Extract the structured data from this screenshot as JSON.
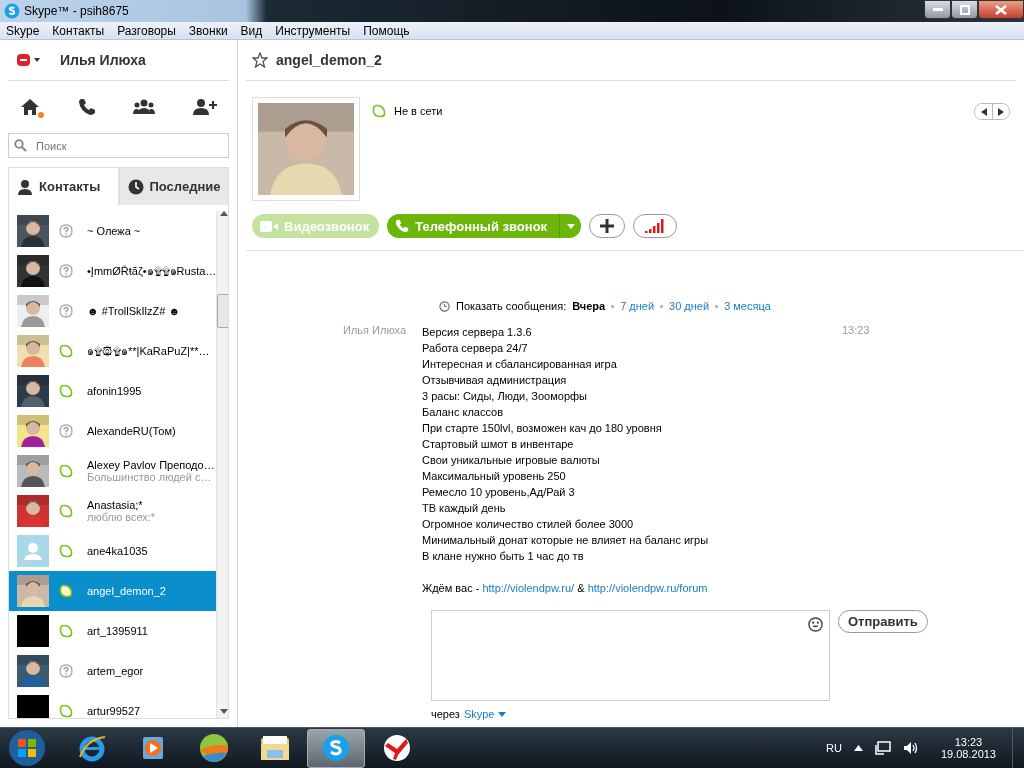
{
  "window": {
    "title": "Skype™ - psih8675"
  },
  "menu": [
    "Skype",
    "Контакты",
    "Разговоры",
    "Звонки",
    "Вид",
    "Инструменты",
    "Помощь"
  ],
  "sidebar": {
    "user": "Илья Илюха",
    "home_badge": true,
    "search": {
      "placeholder": "Поиск"
    },
    "tabs": [
      {
        "label": "Контакты",
        "selected": true
      },
      {
        "label": "Последние",
        "selected": false
      }
    ],
    "contacts": [
      {
        "name": "~ Олежа ~",
        "status_known": false,
        "kind": "picture",
        "selected": false
      },
      {
        "name": "•ĮmmØŘŧãζ•๑۩۩๑Rusta…",
        "status_known": false,
        "kind": "picture",
        "selected": false
      },
      {
        "name": "☻ #TrollSkIlzZ# ☻",
        "status_known": false,
        "kind": "picture",
        "selected": false
      },
      {
        "name": "๑۩۞۩๑**|KaRaPuZ|**…",
        "status_known": true,
        "kind": "picture",
        "selected": false
      },
      {
        "name": "afonin1995",
        "status_known": true,
        "kind": "picture",
        "selected": false
      },
      {
        "name": "AlexandeRU(Том)",
        "status_known": false,
        "kind": "picture",
        "selected": false
      },
      {
        "name": "Alexey Pavlov Преподо…",
        "mood": "Большинство людей с…",
        "status_known": true,
        "kind": "picture",
        "selected": false
      },
      {
        "name": "Anastasia;*",
        "mood": "люблю всех:*",
        "status_known": true,
        "kind": "picture",
        "selected": false
      },
      {
        "name": "ane4ka1035",
        "status_known": true,
        "kind": "default",
        "selected": false
      },
      {
        "name": "angel_demon_2",
        "status_known": true,
        "kind": "picture",
        "selected": true
      },
      {
        "name": "art_1395911",
        "status_known": true,
        "kind": "blank",
        "selected": false
      },
      {
        "name": "artem_egor",
        "status_known": false,
        "kind": "picture",
        "selected": false
      },
      {
        "name": "artur99527",
        "status_known": true,
        "kind": "blank",
        "selected": false
      }
    ]
  },
  "conversation": {
    "name": "angel_demon_2",
    "status_known": true,
    "status_text": "Не в сети",
    "buttons": [
      {
        "kind": "video",
        "label": "Видеозвонок",
        "disabled": true
      },
      {
        "kind": "phone",
        "label": "Телефонный звонок",
        "disabled": false
      },
      {
        "kind": "add",
        "disabled": false
      },
      {
        "kind": "signal",
        "disabled": false
      }
    ],
    "history": {
      "label": "Показать сообщения:",
      "options": [
        {
          "label": "Вчера",
          "selected": true
        },
        {
          "label": "7 дней",
          "selected": false
        },
        {
          "label": "30 дней",
          "selected": false
        },
        {
          "label": "3 месяца",
          "selected": false
        }
      ]
    },
    "message": {
      "sender": "Илья Илюха",
      "time": "13:23",
      "lines": [
        "Версия сервера 1.3.6",
        "Работа сервера 24/7",
        "Интересная и сбалансированная игра",
        "Отзывчивая администрация",
        "3 расы: Сиды, Люди, Зооморфы",
        "Баланс классов",
        "При старте 150lvl, возможен кач до 180 уровня",
        "Стартовый шмот в инвентаре",
        "Свои уникальные игровые валюты",
        "Максимальный уровень 250",
        "Ремесло 10 уровень,Ад/Рай 3",
        "ТВ каждый день",
        "Огромное количество стилей более 3000",
        "Минимальный донат которые не влияет на баланс игры",
        "В клане нужно быть 1 час до тв"
      ],
      "footer": [
        {
          "kind": "text",
          "text": "Ждём вас - "
        },
        {
          "kind": "link",
          "text": "http://violendpw.ru/"
        },
        {
          "kind": "text",
          "text": " & "
        },
        {
          "kind": "link",
          "text": "http://violendpw.ru/forum"
        }
      ]
    },
    "send_button": "Отправить",
    "via": {
      "label": "через",
      "service": "Skype"
    }
  },
  "taskbar": {
    "apps": [
      {
        "kind": "ie",
        "selected": false
      },
      {
        "kind": "media",
        "selected": false
      },
      {
        "kind": "ball",
        "selected": false
      },
      {
        "kind": "folder",
        "selected": false
      },
      {
        "kind": "skype",
        "selected": true
      },
      {
        "kind": "yandex",
        "selected": false
      }
    ],
    "language": "RU",
    "time": "13:23",
    "date": "19.08.2013"
  }
}
